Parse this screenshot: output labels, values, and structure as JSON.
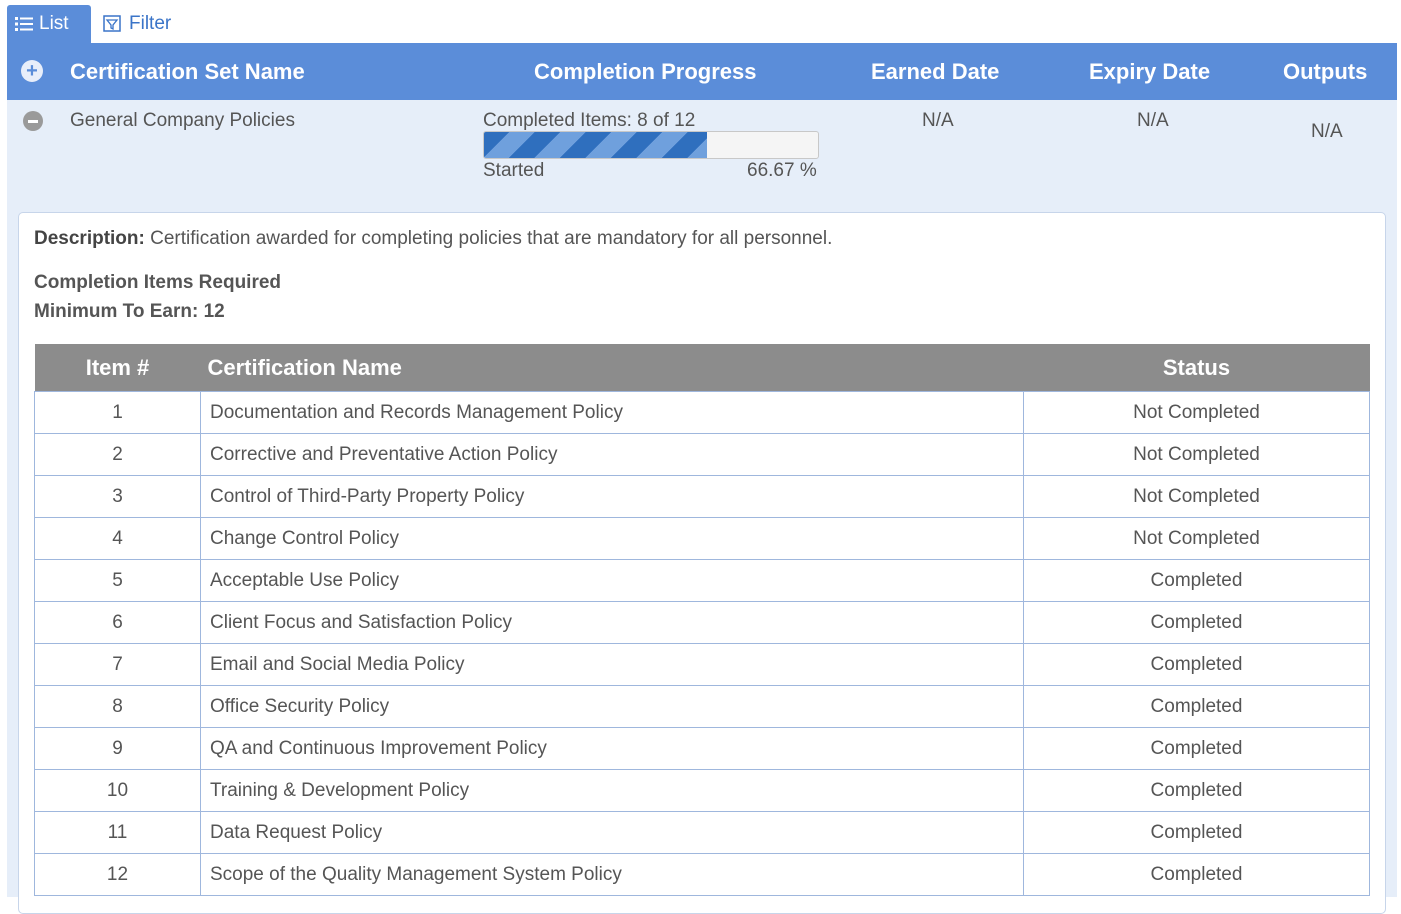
{
  "tabs": [
    {
      "label": "List",
      "icon": "list-icon",
      "active": true
    },
    {
      "label": "Filter",
      "icon": "filter-icon",
      "active": false
    }
  ],
  "header": {
    "name": "Certification Set Name",
    "progress": "Completion Progress",
    "earned": "Earned Date",
    "expiry": "Expiry Date",
    "outputs": "Outputs"
  },
  "row": {
    "name": "General Company Policies",
    "completed_text": "Completed Items: 8 of 12",
    "progress_percent": 66.67,
    "status": "Started",
    "percent_text": "66.67 %",
    "earned": "N/A",
    "expiry": "N/A",
    "outputs": "N/A"
  },
  "detail": {
    "description_label": "Description:",
    "description": "Certification awarded for completing policies that are mandatory for all personnel.",
    "required_title": "Completion Items Required",
    "minimum_label": "Minimum To Earn: 12"
  },
  "items_table": {
    "columns": [
      "Item #",
      "Certification Name",
      "Status"
    ],
    "rows": [
      {
        "num": "1",
        "name": "Documentation and Records Management Policy",
        "status": "Not Completed"
      },
      {
        "num": "2",
        "name": "Corrective and Preventative Action Policy",
        "status": "Not Completed"
      },
      {
        "num": "3",
        "name": "Control of Third-Party Property Policy",
        "status": "Not Completed"
      },
      {
        "num": "4",
        "name": "Change Control Policy",
        "status": "Not Completed"
      },
      {
        "num": "5",
        "name": "Acceptable Use Policy",
        "status": "Completed"
      },
      {
        "num": "6",
        "name": "Client Focus and Satisfaction Policy",
        "status": "Completed"
      },
      {
        "num": "7",
        "name": "Email and Social Media Policy",
        "status": "Completed"
      },
      {
        "num": "8",
        "name": "Office Security Policy",
        "status": "Completed"
      },
      {
        "num": "9",
        "name": "QA and Continuous Improvement Policy",
        "status": "Completed"
      },
      {
        "num": "10",
        "name": "Training & Development Policy",
        "status": "Completed"
      },
      {
        "num": "11",
        "name": "Data Request Policy",
        "status": "Completed"
      },
      {
        "num": "12",
        "name": "Scope of the Quality Management System Policy",
        "status": "Completed"
      }
    ]
  },
  "colors": {
    "header_blue": "#5b8dd9",
    "row_bg": "#e6eef9",
    "not_completed": "#e8141e",
    "completed": "#1f9a2a",
    "table_header": "#8c8c8c"
  }
}
